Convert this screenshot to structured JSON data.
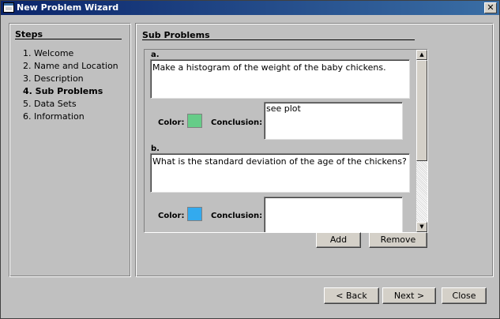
{
  "window": {
    "title": "New Problem Wizard",
    "close_glyph": "✕"
  },
  "steps": {
    "heading": "Steps",
    "items": [
      "1. Welcome",
      "2. Name and Location",
      "3. Description",
      "4. Sub Problems",
      "5. Data Sets",
      "6. Information"
    ],
    "current": "4. Sub Problems"
  },
  "main": {
    "heading": "Sub Problems",
    "subproblems": [
      {
        "label": "a.",
        "text": "Make a histogram of the weight of the baby chickens.",
        "color_label": "Color:",
        "color": "#66cc88",
        "conclusion_label": "Conclusion:",
        "conclusion": "see plot"
      },
      {
        "label": "b.",
        "text": "What is the standard deviation of the age of the chickens?",
        "color_label": "Color:",
        "color": "#33aaee",
        "conclusion_label": "Conclusion:",
        "conclusion": ""
      }
    ],
    "add_label": "Add",
    "remove_label": "Remove",
    "scroll_up": "▲",
    "scroll_down": "▼"
  },
  "footer": {
    "back_label": "< Back",
    "next_label": "Next >",
    "close_label": "Close"
  }
}
